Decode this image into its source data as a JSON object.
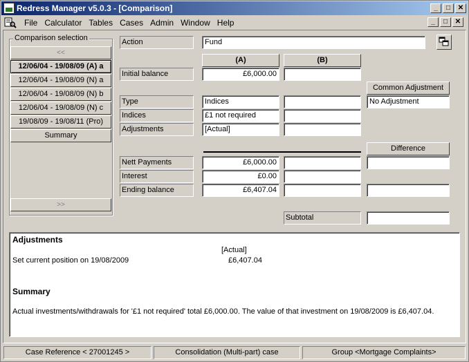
{
  "window": {
    "title": "Redress Manager v5.0.3 - [Comparison]"
  },
  "title_buttons": {
    "minimize": "_",
    "maximize": "□",
    "close": "✕"
  },
  "menu": [
    "File",
    "Calculator",
    "Tables",
    "Cases",
    "Admin",
    "Window",
    "Help"
  ],
  "comparison_selection": {
    "legend": "Comparison selection",
    "prev": "<<",
    "next": ">>",
    "items": [
      "12/06/04 - 19/08/09 (A) a",
      "12/06/04 - 19/08/09 (N) a",
      "12/06/04 - 19/08/09 (N) b",
      "12/06/04 - 19/08/09 (N) c",
      "19/08/09 - 19/08/11 (Pro)",
      "Summary"
    ],
    "selected_index": 0
  },
  "form": {
    "action_label": "Action",
    "action_value": "Fund",
    "col_a": "(A)",
    "col_b": "(B)",
    "initial_balance_label": "Initial balance",
    "initial_balance_a": "£6,000.00",
    "initial_balance_b": "",
    "common_adjustment_header": "Common Adjustment",
    "common_adjustment_value": "No Adjustment",
    "type_label": "Type",
    "type_a": "Indices",
    "type_b": "",
    "indices_label": "Indices",
    "indices_a": "£1 not required",
    "indices_b": "",
    "adjustments_label": "Adjustments",
    "adjustments_a": "[Actual]",
    "adjustments_b": "",
    "difference_header": "Difference",
    "nett_payments_label": "Nett Payments",
    "nett_payments_a": "£6,000.00",
    "nett_payments_b": "",
    "nett_payments_diff": "",
    "interest_label": "Interest",
    "interest_a": "£0.00",
    "interest_b": "",
    "ending_balance_label": "Ending balance",
    "ending_balance_a": "£6,407.04",
    "ending_balance_b": "",
    "ending_balance_diff": "",
    "subtotal_label": "Subtotal",
    "subtotal_value": ""
  },
  "report": {
    "adjustments_heading": "Adjustments",
    "actual_header": "[Actual]",
    "position_text": "Set current position on 19/08/2009",
    "position_value": "£6,407.04",
    "summary_heading": "Summary",
    "summary_text": "Actual investments/withdrawals for '£1 not required' total £6,000.00. The value of that investment on 19/08/2009 is £6,407.04."
  },
  "status": {
    "case_reference": "Case Reference < 27001245 >",
    "consolidation": "Consolidation (Multi-part) case",
    "group": "Group <Mortgage Complaints>"
  },
  "icons": {
    "app": "calculator-app-icon",
    "menu": "document-search-icon",
    "copy": "copy-windows-icon"
  }
}
